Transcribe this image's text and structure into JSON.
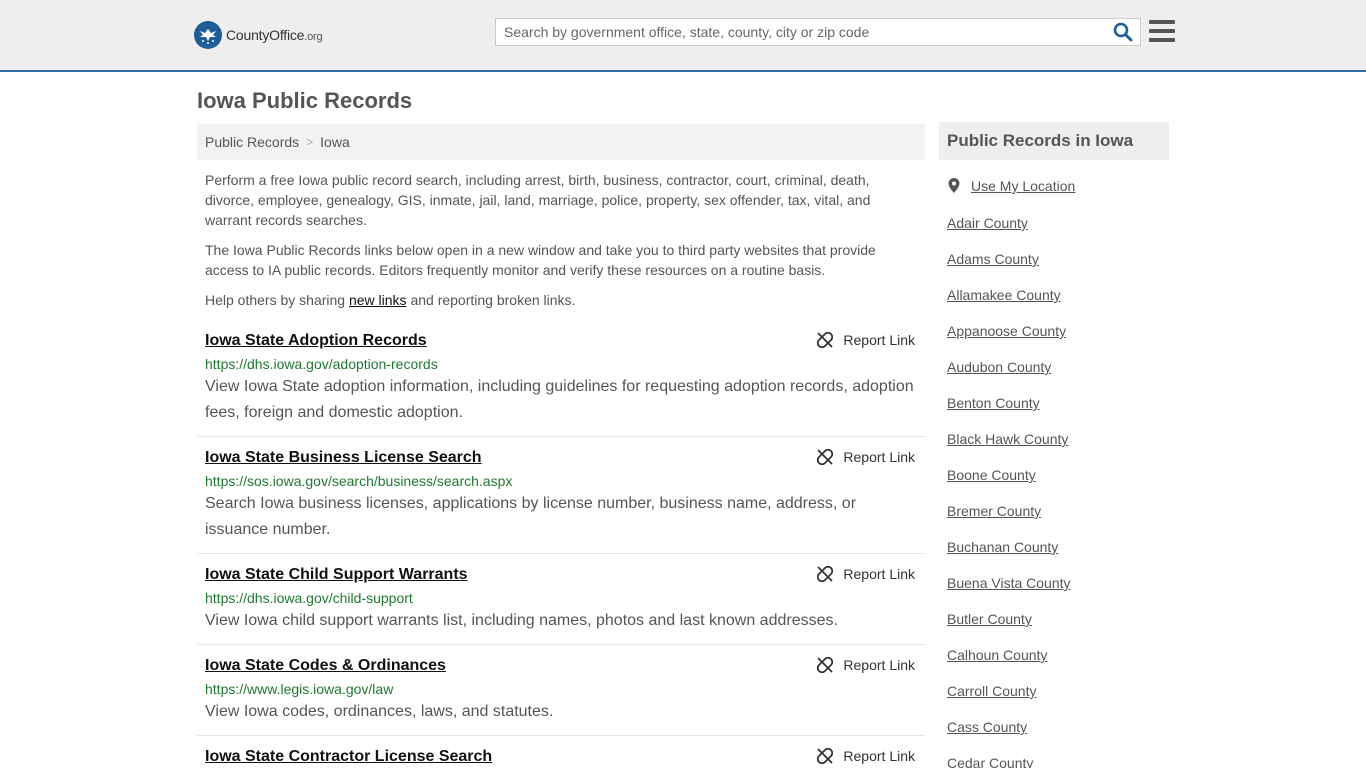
{
  "header": {
    "logo_main": "CountyOffice",
    "logo_tld": ".org",
    "search_placeholder": "Search by government office, state, county, city or zip code"
  },
  "page": {
    "title": "Iowa Public Records"
  },
  "breadcrumb": {
    "items": [
      "Public Records",
      "Iowa"
    ],
    "separator": ">"
  },
  "intro": {
    "p1": "Perform a free Iowa public record search, including arrest, birth, business, contractor, court, criminal, death, divorce, employee, genealogy, GIS, inmate, jail, land, marriage, police, property, sex offender, tax, vital, and warrant records searches.",
    "p2": "The Iowa Public Records links below open in a new window and take you to third party websites that provide access to IA public records. Editors frequently monitor and verify these resources on a routine basis.",
    "p3_before": "Help others by sharing ",
    "p3_link": "new links",
    "p3_after": " and reporting broken links."
  },
  "report_label": "Report Link",
  "records": [
    {
      "title": "Iowa State Adoption Records",
      "url": "https://dhs.iowa.gov/adoption-records",
      "desc": "View Iowa State adoption information, including guidelines for requesting adoption records, adoption fees, foreign and domestic adoption."
    },
    {
      "title": "Iowa State Business License Search",
      "url": "https://sos.iowa.gov/search/business/search.aspx",
      "desc": "Search Iowa business licenses, applications by license number, business name, address, or issuance number."
    },
    {
      "title": "Iowa State Child Support Warrants",
      "url": "https://dhs.iowa.gov/child-support",
      "desc": "View Iowa child support warrants list, including names, photos and last known addresses."
    },
    {
      "title": "Iowa State Codes & Ordinances",
      "url": "https://www.legis.iowa.gov/law",
      "desc": "View Iowa codes, ordinances, laws, and statutes."
    },
    {
      "title": "Iowa State Contractor License Search",
      "url": "",
      "desc": ""
    }
  ],
  "sidebar": {
    "heading": "Public Records in Iowa",
    "use_location": "Use My Location",
    "counties": [
      "Adair County",
      "Adams County",
      "Allamakee County",
      "Appanoose County",
      "Audubon County",
      "Benton County",
      "Black Hawk County",
      "Boone County",
      "Bremer County",
      "Buchanan County",
      "Buena Vista County",
      "Butler County",
      "Calhoun County",
      "Carroll County",
      "Cass County",
      "Cedar County"
    ]
  },
  "colors": {
    "header_bg": "#eeeeee",
    "header_border": "#2e6da4",
    "logo_badge": "#1f5d99",
    "url_green": "#1e7a2e",
    "search_icon": "#1f5d99"
  }
}
